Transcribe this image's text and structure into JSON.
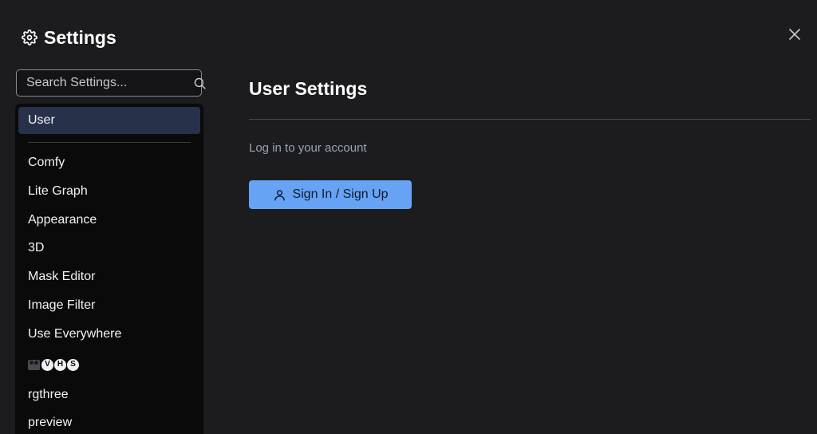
{
  "header": {
    "title": "Settings",
    "icon": "gear-icon",
    "close_icon": "close-icon"
  },
  "search": {
    "placeholder": "Search Settings...",
    "value": "",
    "icon": "search-icon"
  },
  "sidebar": {
    "items": [
      {
        "label": "User",
        "active": true
      },
      {
        "label": "Comfy"
      },
      {
        "label": "Lite Graph"
      },
      {
        "label": "Appearance"
      },
      {
        "label": "3D"
      },
      {
        "label": "Mask Editor"
      },
      {
        "label": "Image Filter"
      },
      {
        "label": "Use Everywhere"
      },
      {
        "label": "🎥🅥🅗🅢",
        "letters": [
          "V",
          "H",
          "S"
        ]
      },
      {
        "label": "rgthree"
      },
      {
        "label": "preview"
      }
    ]
  },
  "main": {
    "title": "User Settings",
    "login_text": "Log in to your account",
    "signin_label": "Sign In / Sign Up",
    "signin_icon": "user-icon"
  },
  "colors": {
    "background": "#1c1c1f",
    "sidebar_bg": "#0a0a0b",
    "active_item": "#27324a",
    "accent": "#66a3f5",
    "muted_text": "#9ba3b4"
  }
}
